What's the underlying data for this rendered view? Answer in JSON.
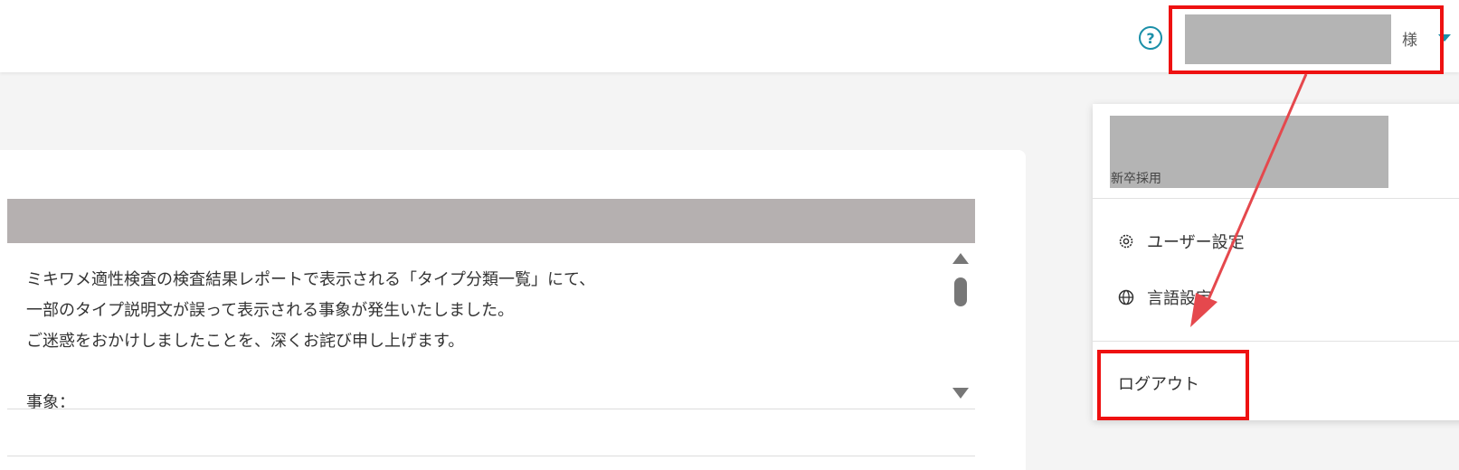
{
  "header": {
    "help_icon_glyph": "?",
    "user_suffix": "様",
    "accent_color": "#1a8fa8"
  },
  "notice": {
    "lines": [
      "ミキワメ適性検査の検査結果レポートで表示される「タイプ分類一覧」にて、",
      "一部のタイプ説明文が誤って表示される事象が発生いたしました。",
      "ご迷惑をおかけしましたことを、深くお詫び申し上げます。",
      "",
      "事象："
    ]
  },
  "dropdown": {
    "subtitle": "新卒採用",
    "items": [
      {
        "label": "ユーザー設定",
        "icon": "gear-icon"
      },
      {
        "label": "言語設定",
        "icon": "globe-icon"
      }
    ],
    "logout_label": "ログアウト"
  },
  "annotation": {
    "color": "#ee1111"
  }
}
